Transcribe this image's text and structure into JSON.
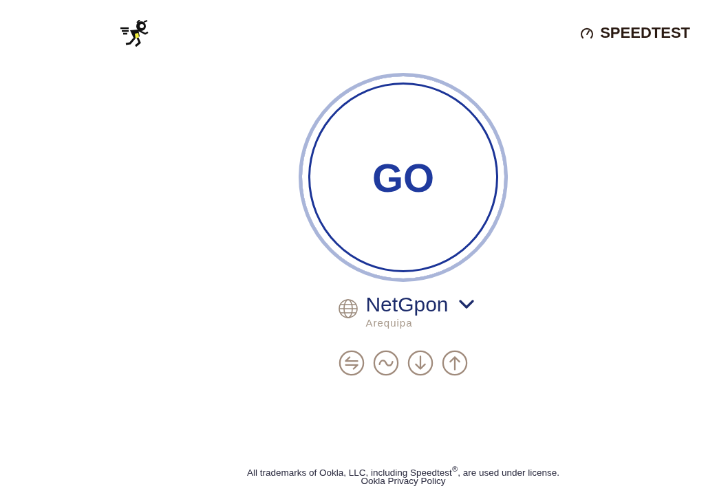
{
  "header": {
    "logo_text": "SPEEDTEST"
  },
  "start_button": {
    "label": "GO"
  },
  "server": {
    "provider": "NetGpon",
    "location": "Arequipa"
  },
  "footer": {
    "notice": "All trademarks of Ookla, LLC, including Speedtest$^{®}$, are used under license.",
    "privacy_link": "Ookla Privacy Policy"
  }
}
